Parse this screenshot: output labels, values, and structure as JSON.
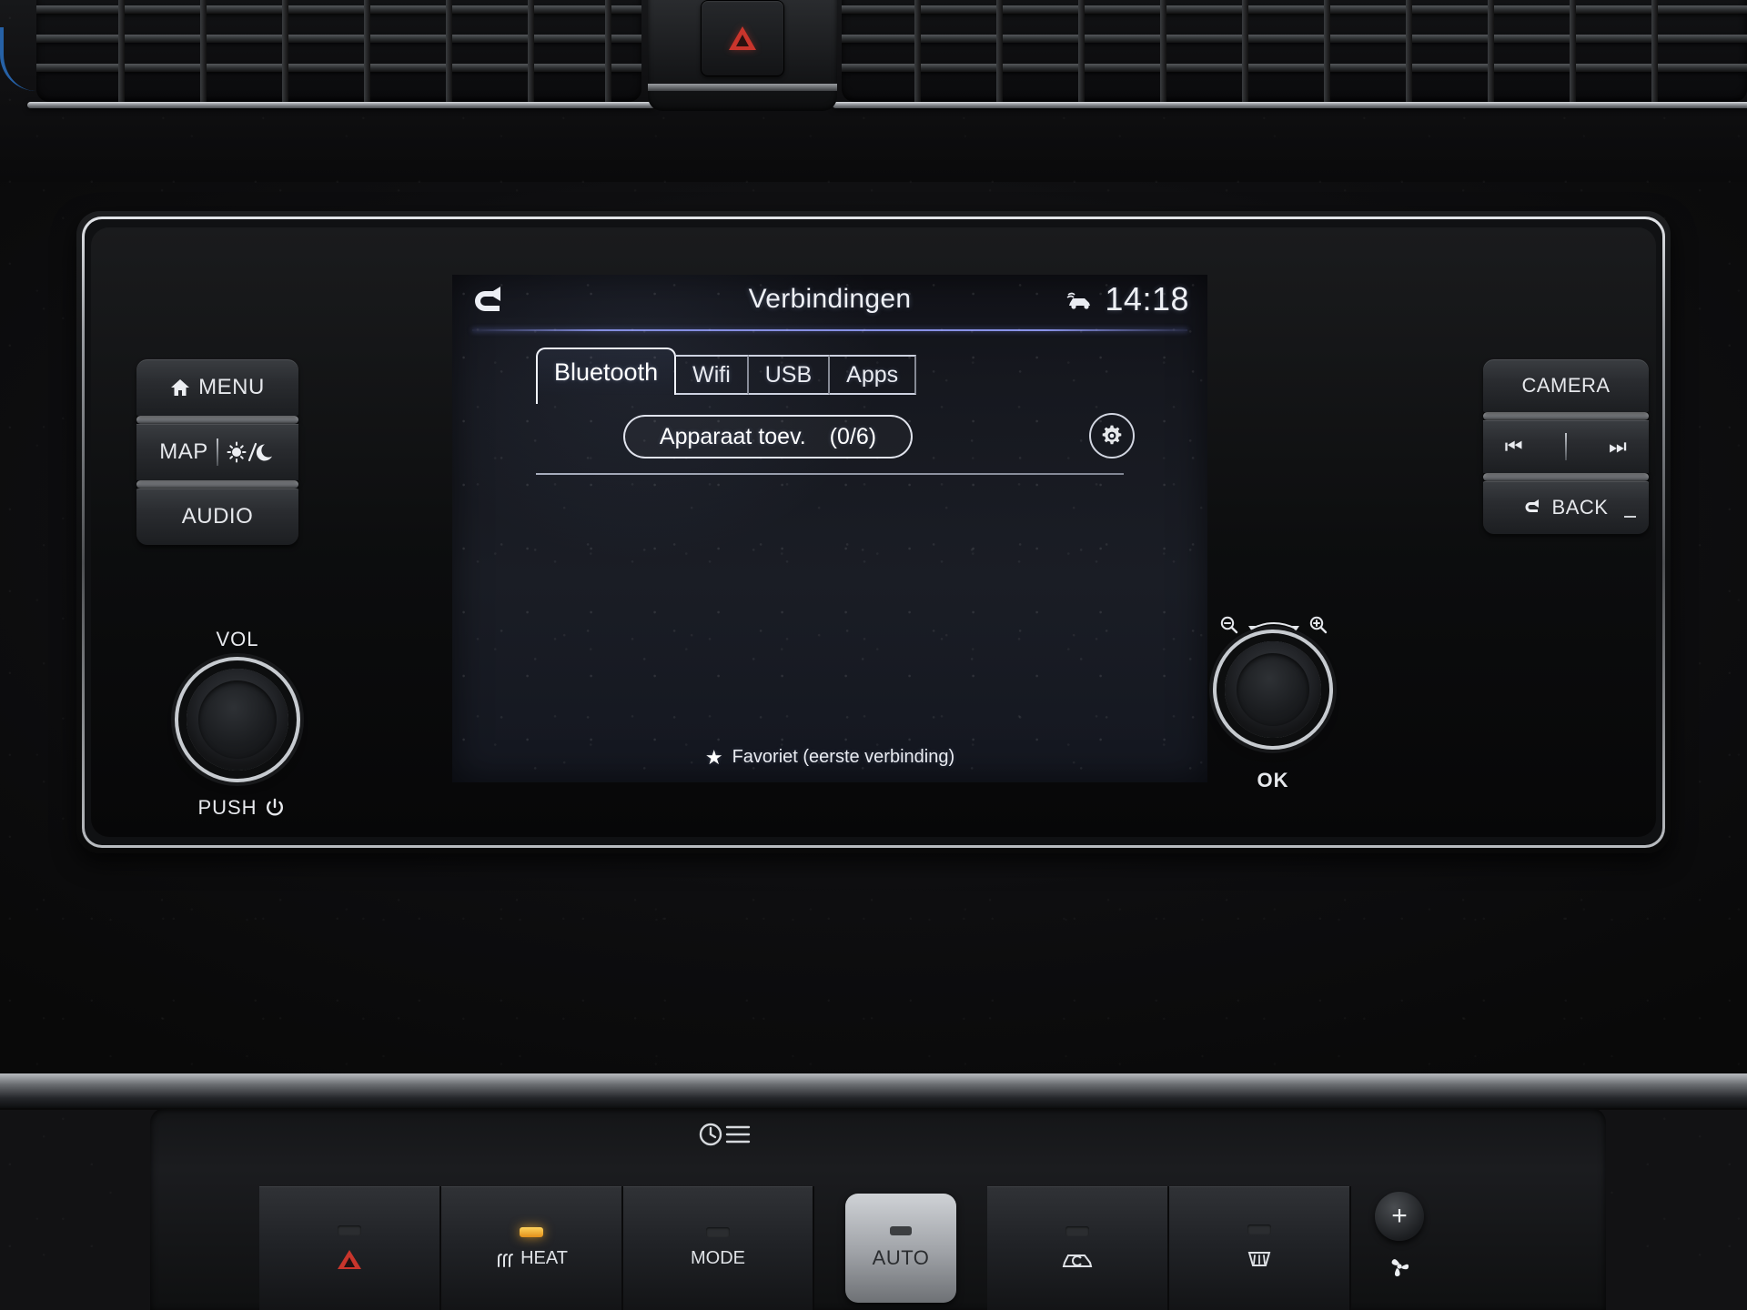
{
  "screen": {
    "title": "Verbindingen",
    "clock": "14:18",
    "eco_icon": "car-eco-icon",
    "back_icon": "back-arrow-icon",
    "tabs": [
      {
        "label": "Bluetooth",
        "active": true
      },
      {
        "label": "Wifi",
        "active": false
      },
      {
        "label": "USB",
        "active": false
      },
      {
        "label": "Apps",
        "active": false
      }
    ],
    "add_device": {
      "label": "Apparaat toev.",
      "count": "(0/6)",
      "paired": 0,
      "capacity": 6
    },
    "settings_icon": "gear-icon",
    "device_list": [],
    "footer": {
      "star": "★",
      "text": "Favoriet (eerste verbinding)"
    },
    "accent_color": "#9aa4ff",
    "text_color": "#eef0f5",
    "background_color": "#161922"
  },
  "left_buttons": [
    {
      "name": "menu",
      "label": "MENU",
      "icon": "home-icon"
    },
    {
      "name": "map",
      "label": "MAP",
      "icon": "sun-moon-icon",
      "secondary": "/"
    },
    {
      "name": "audio",
      "label": "AUDIO",
      "icon": ""
    }
  ],
  "right_buttons": [
    {
      "name": "camera",
      "label": "CAMERA",
      "icon": ""
    },
    {
      "name": "track",
      "label": "",
      "icon_prev": "⏮",
      "icon_next": "⏭"
    },
    {
      "name": "back",
      "label": "BACK",
      "icon": "back-arrow-icon"
    }
  ],
  "knobs": {
    "volume": {
      "top_label": "VOL",
      "bottom_label": "PUSH",
      "power_glyph": "⏻"
    },
    "tune": {
      "bottom_label": "OK",
      "zoom_out": "zoom-out-icon",
      "zoom_in": "zoom-in-icon"
    }
  },
  "hvac": {
    "buttons": [
      {
        "name": "hazard",
        "label": "",
        "icon": "warning-triangle-icon",
        "led": "off"
      },
      {
        "name": "seat-heat",
        "label": "HEAT",
        "icon": "heat-waves-icon",
        "led": "amber"
      },
      {
        "name": "mode",
        "label": "MODE",
        "icon": "",
        "led": "off"
      },
      {
        "name": "auto",
        "label": "AUTO",
        "icon": "",
        "led": "off"
      },
      {
        "name": "recirculation",
        "label": "",
        "icon": "recirculate-icon",
        "led": "off"
      },
      {
        "name": "rear-defrost",
        "label": "",
        "icon": "rear-defrost-icon",
        "led": "off"
      }
    ],
    "temp_up": "+",
    "fan_icon": "fan-icon",
    "timer_icon": "front-defrost-icon"
  },
  "hazard_button": {
    "name": "hazard-lights",
    "icon": "red-triangle-icon",
    "color": "#c8352c"
  }
}
